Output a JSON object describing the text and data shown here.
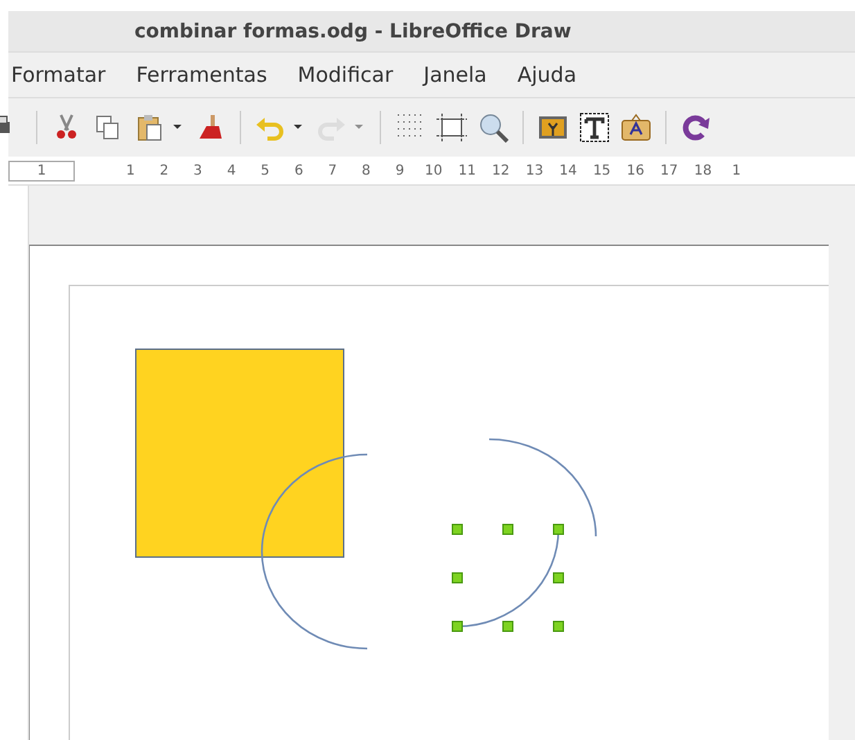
{
  "window": {
    "title": "combinar formas.odg - LibreOffice Draw"
  },
  "menu": [
    "Formatar",
    "Ferramentas",
    "Modificar",
    "Janela",
    "Ajuda"
  ],
  "toolbar": [
    {
      "kind": "print",
      "disabled": false
    },
    {
      "kind": "sep"
    },
    {
      "kind": "cut",
      "disabled": false
    },
    {
      "kind": "copy",
      "disabled": false
    },
    {
      "kind": "paste",
      "disabled": false
    },
    {
      "kind": "caret",
      "disabled": false
    },
    {
      "kind": "brush",
      "disabled": false
    },
    {
      "kind": "sep"
    },
    {
      "kind": "undo",
      "disabled": false
    },
    {
      "kind": "caret",
      "disabled": false
    },
    {
      "kind": "redo",
      "disabled": true
    },
    {
      "kind": "caret",
      "disabled": true
    },
    {
      "kind": "sep"
    },
    {
      "kind": "grid",
      "disabled": false
    },
    {
      "kind": "guides",
      "disabled": false
    },
    {
      "kind": "zoom",
      "disabled": false
    },
    {
      "kind": "sep"
    },
    {
      "kind": "image",
      "disabled": false
    },
    {
      "kind": "text",
      "disabled": false
    },
    {
      "kind": "fontwork",
      "disabled": false
    },
    {
      "kind": "sep"
    },
    {
      "kind": "rotate",
      "disabled": false
    }
  ],
  "ruler": [
    "1",
    "1",
    "2",
    "3",
    "4",
    "5",
    "6",
    "7",
    "8",
    "9",
    "10",
    "11",
    "12",
    "13",
    "14",
    "15",
    "16",
    "17",
    "18",
    "1"
  ],
  "canvas": {
    "shapes": [
      {
        "kind": "rect",
        "color": "#ffd320",
        "selected": false
      },
      {
        "kind": "arc-left",
        "selected": false
      },
      {
        "kind": "arc-top-right",
        "selected": false
      },
      {
        "kind": "arc-small",
        "selected": true
      }
    ]
  }
}
